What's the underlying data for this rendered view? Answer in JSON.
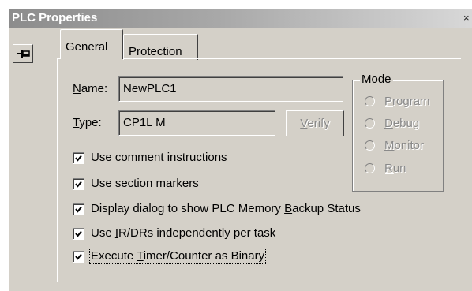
{
  "window": {
    "title": "PLC Properties",
    "close_glyph": "×"
  },
  "tabs": [
    {
      "label": "General",
      "selected": true
    },
    {
      "label": "Protection",
      "selected": false
    }
  ],
  "general": {
    "name_label": "Name:",
    "name_value": "NewPLC1",
    "type_label": "Type:",
    "type_value": "CP1L M",
    "verify_label": "Verify"
  },
  "mode": {
    "legend": "Mode",
    "options": [
      {
        "label": "Program",
        "enabled": false,
        "selected": false
      },
      {
        "label": "Debug",
        "enabled": false,
        "selected": false
      },
      {
        "label": "Monitor",
        "enabled": false,
        "selected": false
      },
      {
        "label": "Run",
        "enabled": false,
        "selected": false
      }
    ]
  },
  "options": [
    {
      "label": "Use comment instructions",
      "checked": true
    },
    {
      "label": "Use section markers",
      "checked": true
    },
    {
      "label": "Display dialog to show PLC Memory Backup Status",
      "checked": true
    },
    {
      "label": "Use IR/DRs independently per task",
      "checked": true
    },
    {
      "label": "Execute Timer/Counter as Binary",
      "checked": true
    }
  ],
  "icons": {
    "pin": "pin-icon",
    "check": "checkmark-icon"
  },
  "colors": {
    "face": "#d4d0c8",
    "title_start": "#8c8c8c",
    "title_end": "#d8d8d8",
    "disabled_text": "#8a8a8a"
  }
}
